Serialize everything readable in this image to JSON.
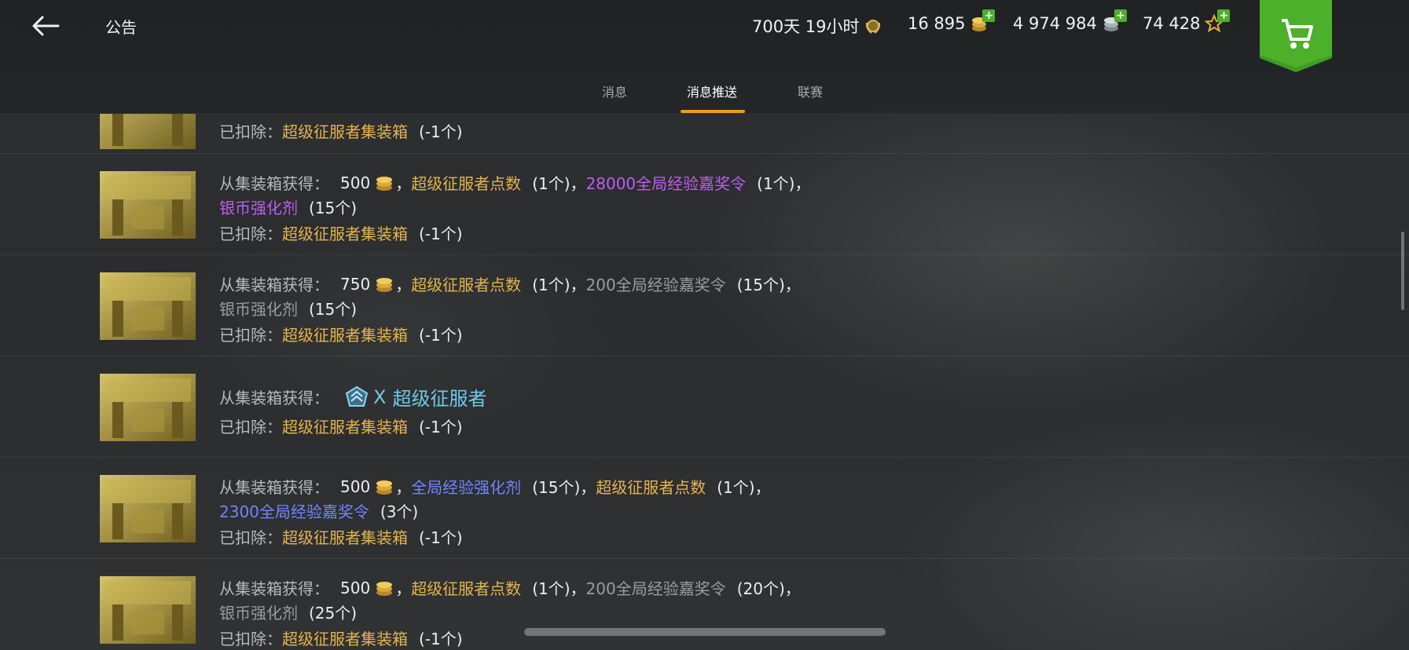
{
  "header": {
    "title": "公告",
    "time_remaining": "700天 19小时",
    "gold": "16 895",
    "silver": "4 974 984",
    "free_xp": "74 428"
  },
  "tabs": [
    {
      "label": "消息"
    },
    {
      "label": "消息推送"
    },
    {
      "label": "联赛"
    }
  ],
  "rows": {
    "r0": {
      "deducted_label": "已扣除：",
      "deducted_item": "超级征服者集装箱",
      "deducted_qty": "(-1个)"
    },
    "r1": {
      "gain_label": "从集装箱获得：",
      "coins": "500",
      "i1": "超级征服者点数",
      "q1": "(1个)",
      "i2": "28000全局经验嘉奖令",
      "q2": "(1个)",
      "i3": "银币强化剂",
      "q3": "(15个)",
      "deducted_label": "已扣除：",
      "deducted_item": "超级征服者集装箱",
      "deducted_qty": "(-1个)"
    },
    "r2": {
      "gain_label": "从集装箱获得：",
      "coins": "750",
      "i1": "超级征服者点数",
      "q1": "(1个)",
      "i2": "200全局经验嘉奖令",
      "q2": "(15个)",
      "i3": "银币强化剂",
      "q3": "(15个)",
      "deducted_label": "已扣除：",
      "deducted_item": "超级征服者集装箱",
      "deducted_qty": "(-1个)"
    },
    "r3": {
      "gain_label": "从集装箱获得：",
      "rank_mark": "X",
      "rank_name": "超级征服者",
      "deducted_label": "已扣除：",
      "deducted_item": "超级征服者集装箱",
      "deducted_qty": "(-1个)"
    },
    "r4": {
      "gain_label": "从集装箱获得：",
      "coins": "500",
      "i1": "全局经验强化剂",
      "q1": "(15个)",
      "i2": "超级征服者点数",
      "q2": "(1个)",
      "i3": "2300全局经验嘉奖令",
      "q3": "(3个)",
      "deducted_label": "已扣除：",
      "deducted_item": "超级征服者集装箱",
      "deducted_qty": "(-1个)"
    },
    "r5": {
      "gain_label": "从集装箱获得：",
      "coins": "500",
      "i1": "超级征服者点数",
      "q1": "(1个)",
      "i2": "200全局经验嘉奖令",
      "q2": "(20个)",
      "i3": "银币强化剂",
      "q3": "(25个)",
      "deducted_label": "已扣除：",
      "deducted_item": "超级征服者集装箱",
      "deducted_qty": "(-1个)"
    }
  },
  "separators": {
    "comma": "，"
  },
  "icons": {
    "back": "back-arrow-icon",
    "time": "laurel-medal-icon",
    "gold": "gold-coins-icon",
    "silver": "silver-coins-icon",
    "free_xp": "star-icon",
    "shop": "cart-icon",
    "crate": "crate-icon",
    "rank": "rank-emblem-icon"
  },
  "colors": {
    "accent_tab": "#f29a1f",
    "item_gold": "#e5b54b",
    "item_purple": "#c05cf0",
    "item_blue": "#6f86ff",
    "item_grey": "#9a9c9e",
    "plus_green": "#4caf2a",
    "shop_green": "#3f9b22",
    "rank_teal": "#6fc8e8"
  }
}
